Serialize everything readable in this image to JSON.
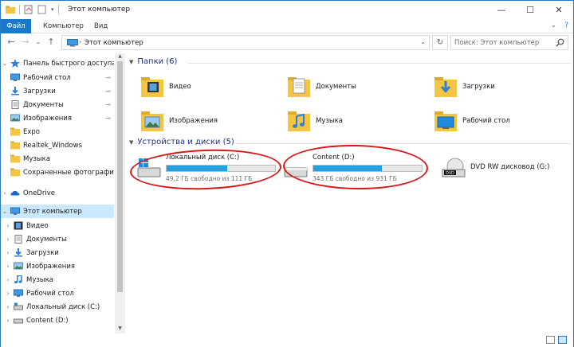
{
  "window": {
    "title": "Этот компьютер",
    "minimize_glyph": "—",
    "maximize_glyph": "☐",
    "close_glyph": "✕"
  },
  "ribbon": {
    "tabs": [
      "Файл",
      "Компьютер",
      "Вид"
    ],
    "chevron": "⌄",
    "help": "?"
  },
  "address": {
    "back": "←",
    "forward": "→",
    "dropdown": "⌄",
    "up": "↑",
    "path": "Этот компьютер",
    "chevron": "›",
    "refresh": "↻",
    "search_placeholder": "Поиск: Этот компьютер"
  },
  "nav": {
    "quick_access": {
      "label": "Панель быстрого доступа",
      "items": [
        {
          "label": "Рабочий стол",
          "pinned": true,
          "icon": "desktop-icon"
        },
        {
          "label": "Загрузки",
          "pinned": true,
          "icon": "downloads-icon"
        },
        {
          "label": "Документы",
          "pinned": true,
          "icon": "documents-icon"
        },
        {
          "label": "Изображения",
          "pinned": true,
          "icon": "pictures-icon"
        },
        {
          "label": "Expo",
          "pinned": false,
          "icon": "folder-icon"
        },
        {
          "label": "Realtek_Windows",
          "pinned": false,
          "icon": "folder-icon"
        },
        {
          "label": "Музыка",
          "pinned": false,
          "icon": "folder-icon"
        },
        {
          "label": "Сохраненные фотографии",
          "pinned": false,
          "icon": "folder-icon"
        }
      ]
    },
    "onedrive": {
      "label": "OneDrive"
    },
    "this_pc": {
      "label": "Этот компьютер",
      "items": [
        {
          "label": "Видео",
          "icon": "video-icon"
        },
        {
          "label": "Документы",
          "icon": "documents-icon"
        },
        {
          "label": "Загрузки",
          "icon": "downloads-icon"
        },
        {
          "label": "Изображения",
          "icon": "pictures-icon"
        },
        {
          "label": "Музыка",
          "icon": "music-icon"
        },
        {
          "label": "Рабочий стол",
          "icon": "desktop-icon"
        },
        {
          "label": "Локальный диск (C:)",
          "icon": "drive-icon"
        },
        {
          "label": "Content (D:)",
          "icon": "drive-icon"
        }
      ]
    },
    "pin_glyph": "📌",
    "expand_glyph": "›",
    "collapse_glyph": "⌄"
  },
  "main": {
    "folders_header": "Папки (6)",
    "folders": [
      {
        "label": "Видео",
        "icon": "video-folder-icon"
      },
      {
        "label": "Документы",
        "icon": "documents-folder-icon"
      },
      {
        "label": "Загрузки",
        "icon": "downloads-folder-icon"
      },
      {
        "label": "Изображения",
        "icon": "pictures-folder-icon"
      },
      {
        "label": "Музыка",
        "icon": "music-folder-icon"
      },
      {
        "label": "Рабочий стол",
        "icon": "desktop-folder-icon"
      }
    ],
    "devices_header": "Устройства и диски (5)",
    "drives": [
      {
        "name": "Локальный диск (C:)",
        "free_text": "49,2 ГБ свободно из 111 ГБ",
        "used_fraction": 0.557,
        "icon": "windows-drive-icon"
      },
      {
        "name": "Content (D:)",
        "free_text": "343 ГБ свободно из 931 ГБ",
        "used_fraction": 0.632,
        "icon": "hdd-icon"
      },
      {
        "name": "DVD RW дисковод (G:)",
        "icon": "dvd-drive-icon",
        "icon_text": "DVD"
      }
    ]
  },
  "colors": {
    "accent": "#1979ca",
    "bar_fill": "#26a0da",
    "annotation": "#d71919",
    "folder_yellow": "#f4c542",
    "selected_bg": "#cce8ff"
  }
}
